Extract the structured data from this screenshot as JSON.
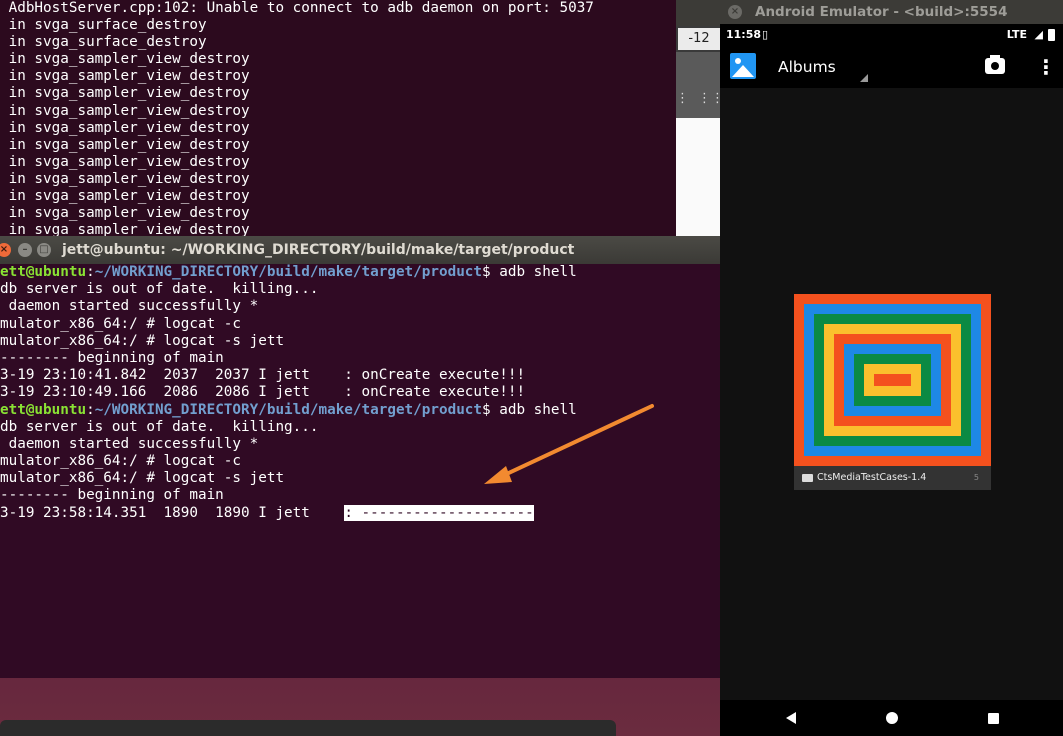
{
  "back_terminal": {
    "lines": [
      " AdbHostServer.cpp:102: Unable to connect to adb daemon on port: 5037",
      " in svga_surface_destroy",
      " in svga_surface_destroy",
      " in svga_sampler_view_destroy",
      " in svga_sampler_view_destroy",
      " in svga_sampler_view_destroy",
      " in svga_sampler_view_destroy",
      " in svga_sampler_view_destroy",
      " in svga_sampler_view_destroy",
      " in svga_sampler_view_destroy",
      " in svga_sampler_view_destroy",
      " in svga_sampler_view_destroy",
      " in svga_sampler_view_destroy",
      " in svga_sampler_view_destroy"
    ]
  },
  "middle_window": {
    "tab_label": "-12",
    "dots_icon": "kebab-menu-icon",
    "grid_icon": "grid-icon"
  },
  "front_terminal": {
    "title": "jett@ubuntu: ~/WORKING_DIRECTORY/build/make/target/product",
    "prompt_user": "ett@ubuntu",
    "prompt_path": "~/WORKING_DIRECTORY/build/make/target/product",
    "lines": [
      {
        "type": "prompt",
        "cmd": "$ adb shell"
      },
      {
        "type": "text",
        "text": "db server is out of date.  killing..."
      },
      {
        "type": "text",
        "text": " daemon started successfully *"
      },
      {
        "type": "text",
        "text": "mulator_x86_64:/ # logcat -c"
      },
      {
        "type": "text",
        "text": "mulator_x86_64:/ # logcat -s jett"
      },
      {
        "type": "text",
        "text": "-------- beginning of main"
      },
      {
        "type": "text",
        "text": "3-19 23:10:41.842  2037  2037 I jett    : onCreate execute!!!"
      },
      {
        "type": "text",
        "text": "3-19 23:10:49.166  2086  2086 I jett    : onCreate execute!!!"
      },
      {
        "type": "prompt",
        "cmd": "$ adb shell"
      },
      {
        "type": "text",
        "text": "db server is out of date.  killing..."
      },
      {
        "type": "text",
        "text": " daemon started successfully *"
      },
      {
        "type": "text",
        "text": "mulator_x86_64:/ # logcat -c"
      },
      {
        "type": "text",
        "text": "mulator_x86_64:/ # logcat -s jett"
      },
      {
        "type": "text",
        "text": "-------- beginning of main"
      },
      {
        "type": "highlight",
        "text": "3-19 23:58:14.351  1890  1890 I jett    ",
        "highlight": ": --------------------"
      }
    ]
  },
  "emulator": {
    "window_title": "Android Emulator - <build>:5554",
    "status": {
      "time": "11:58",
      "sim_icon": "sim-card-icon",
      "network": "LTE",
      "signal_icon": "signal-icon",
      "battery_icon": "battery-icon"
    },
    "app_bar": {
      "title": "Albums",
      "camera_icon": "camera-icon",
      "more_icon": "more-vert-icon"
    },
    "album": {
      "name": "CtsMediaTestCases-1.4",
      "count": "5"
    },
    "colors": {
      "red": "#f4511e",
      "blue": "#1e88e5",
      "green": "#0b8a43",
      "yellow": "#fbc02d"
    }
  },
  "annotation": {
    "arrow_color": "#f28a30"
  }
}
